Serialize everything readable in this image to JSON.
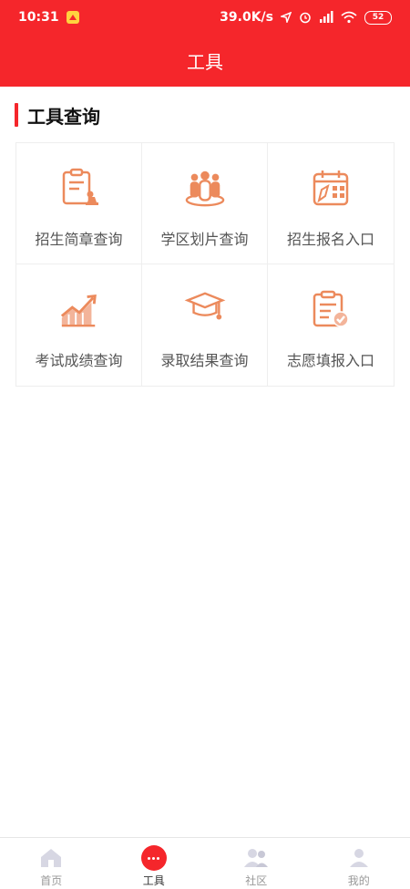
{
  "status_bar": {
    "time": "10:31",
    "net_speed": "39.0K/s",
    "battery": "52"
  },
  "header": {
    "title": "工具"
  },
  "section": {
    "title": "工具查询"
  },
  "tools": [
    {
      "label": "招生简章查询",
      "icon": "brochure-icon"
    },
    {
      "label": "学区划片查询",
      "icon": "people-group-icon"
    },
    {
      "label": "招生报名入口",
      "icon": "calendar-signup-icon"
    },
    {
      "label": "考试成绩查询",
      "icon": "chart-growth-icon"
    },
    {
      "label": "录取结果查询",
      "icon": "graduation-cap-icon"
    },
    {
      "label": "志愿填报入口",
      "icon": "clipboard-check-icon"
    }
  ],
  "bottom_nav": {
    "items": [
      {
        "label": "首页",
        "icon": "home-icon"
      },
      {
        "label": "工具",
        "icon": "more-dots-icon",
        "active": true
      },
      {
        "label": "社区",
        "icon": "community-icon"
      },
      {
        "label": "我的",
        "icon": "profile-icon"
      }
    ]
  },
  "colors": {
    "primary": "#f5262b",
    "icon_orange": "#ec8a5c",
    "border": "#eeeeee"
  }
}
